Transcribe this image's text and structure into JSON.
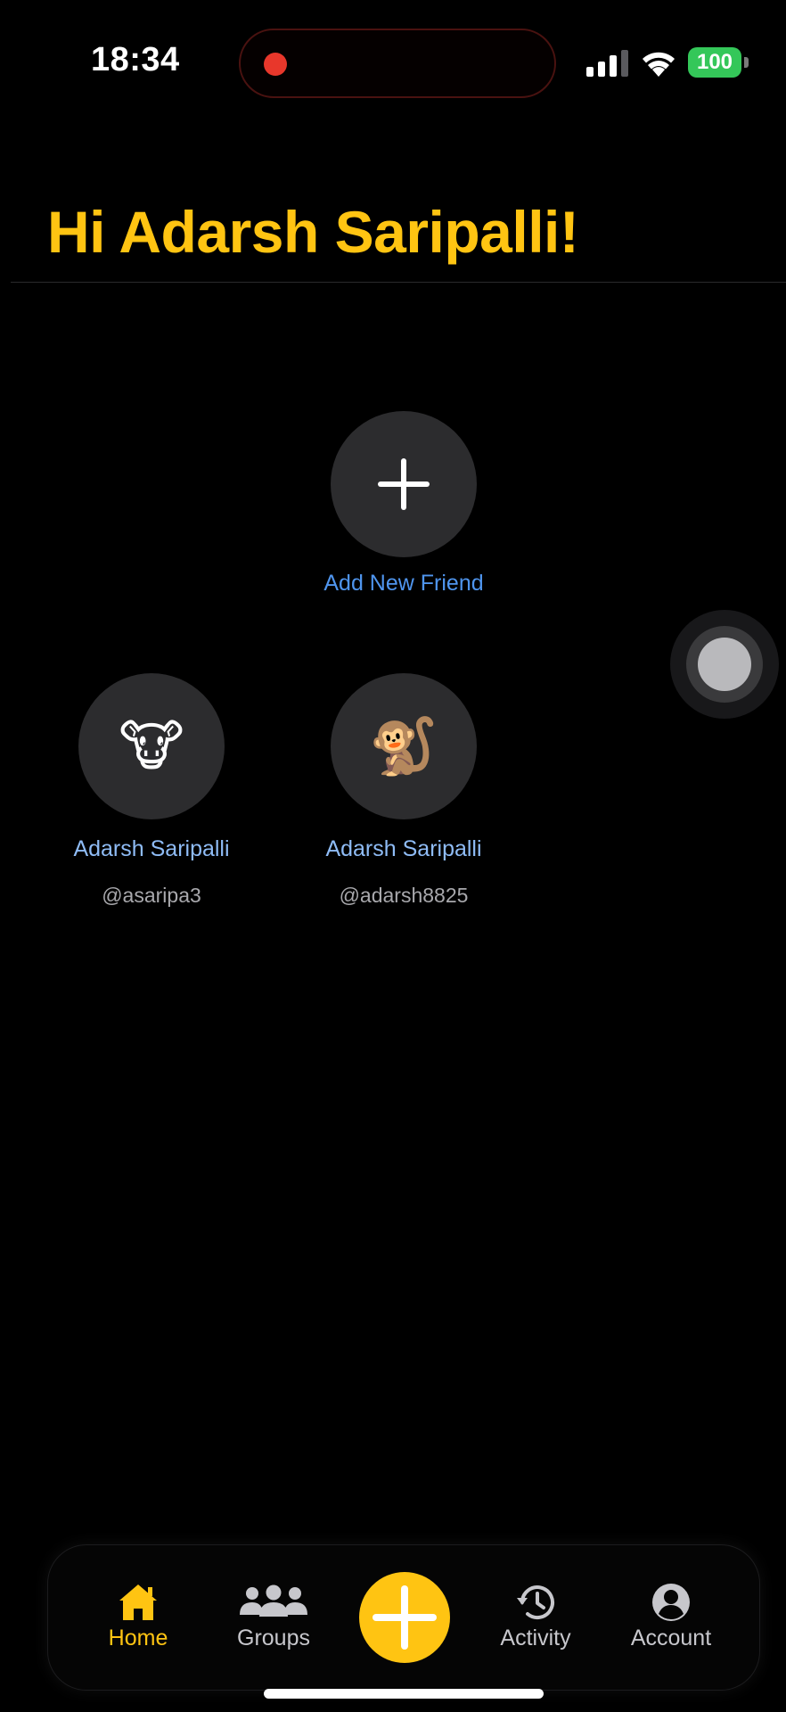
{
  "status_bar": {
    "time": "18:34",
    "battery_level": "100",
    "recording": true
  },
  "header": {
    "greeting": "Hi Adarsh Saripalli!"
  },
  "add_friend": {
    "label": "Add New Friend",
    "icon": "plus-icon"
  },
  "friends": [
    {
      "name": "Adarsh Saripalli",
      "handle": "@asaripa3",
      "avatar": "🐮"
    },
    {
      "name": "Adarsh Saripalli",
      "handle": "@adarsh8825",
      "avatar": "🐒"
    }
  ],
  "tab_bar": {
    "items": [
      {
        "label": "Home",
        "icon": "home-icon",
        "active": true
      },
      {
        "label": "Groups",
        "icon": "groups-icon",
        "active": false
      },
      {
        "label": "",
        "icon": "plus-icon",
        "active": false
      },
      {
        "label": "Activity",
        "icon": "history-icon",
        "active": false
      },
      {
        "label": "Account",
        "icon": "account-icon",
        "active": false
      }
    ]
  },
  "colors": {
    "accent": "#ffc412",
    "link": "#4f95ee",
    "friend_name": "#8fbcf6",
    "battery": "#34c759",
    "background": "#000000"
  }
}
